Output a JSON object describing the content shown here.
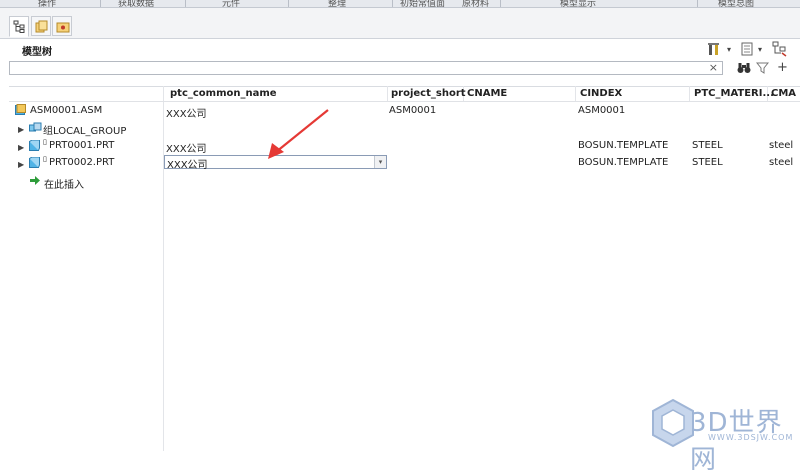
{
  "menu": [
    "操作",
    "获取数据",
    "元件",
    "整理",
    "初始常值面",
    "原材料",
    "模型显示",
    "模型总图"
  ],
  "panel": {
    "title": "模型树"
  },
  "search": {
    "value": "",
    "placeholder": ""
  },
  "columns": [
    "ptc_common_name",
    "project_short",
    "CNAME",
    "CINDEX",
    "PTC_MATERI...",
    "CMA"
  ],
  "rows": [
    {
      "name": "ASM0001.ASM",
      "ptc_common_name": "XXX公司",
      "project_short": "ASM0001",
      "cname": "",
      "cindex": "ASM0001",
      "material": "",
      "cma": ""
    },
    {
      "name": "组LOCAL_GROUP",
      "ptc_common_name": "",
      "project_short": "",
      "cname": "",
      "cindex": "",
      "material": "",
      "cma": ""
    },
    {
      "name": "PRT0001.PRT",
      "ptc_common_name": "XXX公司",
      "project_short": "",
      "cname": "",
      "cindex": "BOSUN.TEMPLATE",
      "material": "STEEL",
      "cma": "steel"
    },
    {
      "name": "PRT0002.PRT",
      "ptc_common_name": "XXX公司",
      "project_short": "",
      "cname": "",
      "cindex": "BOSUN.TEMPLATE",
      "material": "STEEL",
      "cma": "steel"
    }
  ],
  "insert_here": "在此插入",
  "watermark": {
    "title": "3D世界网",
    "url": "WWW.3DSJW.COM"
  },
  "colors": {
    "accent_arrow": "#e53935",
    "asm_icon": "#3aa0d8",
    "insert_arrow": "#2e9c3a"
  }
}
